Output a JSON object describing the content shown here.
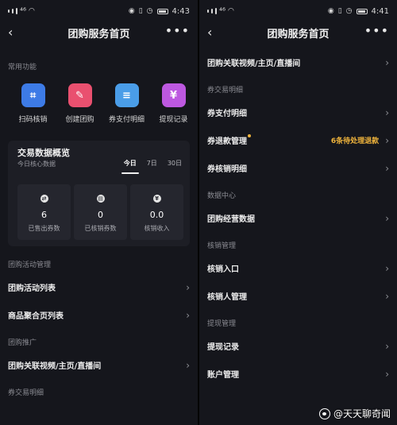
{
  "left": {
    "status": {
      "carrier": "⁴⁶",
      "time": "4:43"
    },
    "nav": {
      "title": "团购服务首页",
      "back": "‹",
      "more": "•••"
    },
    "common_label": "常用功能",
    "quick": [
      {
        "label": "扫码核销",
        "icon": "scan-icon",
        "glyph": "⌗",
        "color": "#3d7be6"
      },
      {
        "label": "创建团购",
        "icon": "create-icon",
        "glyph": "✎",
        "color": "#e9506f"
      },
      {
        "label": "券支付明细",
        "icon": "list-icon",
        "glyph": "≡",
        "color": "#4a9de8"
      },
      {
        "label": "提现记录",
        "icon": "withdraw-icon",
        "glyph": "¥",
        "color": "#bd58e0"
      }
    ],
    "card": {
      "title": "交易数据概览",
      "subtitle": "今日核心数据",
      "tabs": [
        "今日",
        "7日",
        "30日"
      ],
      "stats": [
        {
          "icon": "coupon-icon",
          "glyph": "⇄",
          "value": "6",
          "label": "已售出券数"
        },
        {
          "icon": "clipboard-icon",
          "glyph": "▤",
          "value": "0",
          "label": "已核销券数"
        },
        {
          "icon": "yen-icon",
          "glyph": "¥",
          "value": "0.0",
          "label": "核销收入"
        }
      ]
    },
    "groups": [
      {
        "label": "团购活动管理",
        "rows": [
          "团购活动列表",
          "商品聚合页列表"
        ]
      },
      {
        "label": "团购推广",
        "rows": [
          "团购关联视频/主页/直播间"
        ]
      },
      {
        "label": "券交易明细",
        "rows": []
      }
    ]
  },
  "right": {
    "status": {
      "carrier": "⁴⁶",
      "time": "4:41"
    },
    "nav": {
      "title": "团购服务首页",
      "back": "‹",
      "more": "•••"
    },
    "top_row": "团购关联视频/主页/直播间",
    "groups": [
      {
        "label": "券交易明细",
        "rows": [
          {
            "label": "券支付明细"
          },
          {
            "label": "券退款管理",
            "dot": true,
            "note": "6条待处理退款"
          },
          {
            "label": "券核销明细"
          }
        ]
      },
      {
        "label": "数据中心",
        "rows": [
          {
            "label": "团购经营数据"
          }
        ]
      },
      {
        "label": "核销管理",
        "rows": [
          {
            "label": "核销入口"
          },
          {
            "label": "核销人管理"
          }
        ]
      },
      {
        "label": "提现管理",
        "rows": [
          {
            "label": "提现记录"
          },
          {
            "label": "账户管理"
          }
        ]
      }
    ],
    "watermark": "@天天聊奇闻"
  },
  "chevron": "›"
}
